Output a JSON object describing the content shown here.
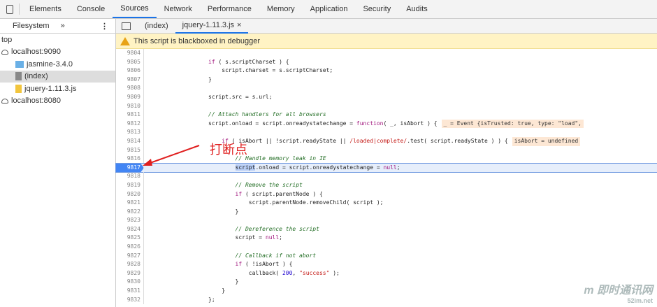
{
  "toolbar": {
    "tabs": [
      "Elements",
      "Console",
      "Sources",
      "Network",
      "Performance",
      "Memory",
      "Application",
      "Security",
      "Audits"
    ],
    "active": "Sources"
  },
  "navigator": {
    "tab": "Filesystem",
    "more": "»",
    "menu": "⋮",
    "tree": [
      {
        "label": "top",
        "type": "frame",
        "indent": 0
      },
      {
        "label": "localhost:9090",
        "type": "cloud",
        "indent": 0
      },
      {
        "label": "jasmine-3.4.0",
        "type": "folder",
        "indent": 1
      },
      {
        "label": "(index)",
        "type": "file-gray",
        "indent": 1,
        "selected": true
      },
      {
        "label": "jquery-1.11.3.js",
        "type": "file-yellow",
        "indent": 1
      },
      {
        "label": "localhost:8080",
        "type": "cloud",
        "indent": 0
      }
    ]
  },
  "editor": {
    "tabs": [
      {
        "label": "(index)"
      },
      {
        "label": "jquery-1.11.3.js",
        "active": true,
        "close": "×"
      }
    ],
    "warning": "This script is blackboxed in debugger",
    "breakpoint_line": 9817,
    "lines": [
      {
        "n": "9804",
        "code": ""
      },
      {
        "n": "9805",
        "code": "if ( s.scriptCharset ) {"
      },
      {
        "n": "9806",
        "code": "    script.charset = s.scriptCharset;"
      },
      {
        "n": "9807",
        "code": "}"
      },
      {
        "n": "9808",
        "code": ""
      },
      {
        "n": "9809",
        "code": "script.src = s.url;"
      },
      {
        "n": "9810",
        "code": ""
      },
      {
        "n": "9811",
        "code": "// Attach handlers for all browsers"
      },
      {
        "n": "9812",
        "code": "script.onload = script.onreadystatechange = function( _, isAbort ) {",
        "inline": "_ = Event {isTrusted: true, type: \"load\","
      },
      {
        "n": "9813",
        "code": ""
      },
      {
        "n": "9814",
        "code": "    if ( isAbort || !script.readyState || /loaded|complete/.test( script.readyState ) ) {",
        "inline": "isAbort = undefined"
      },
      {
        "n": "9815",
        "code": ""
      },
      {
        "n": "9816",
        "code": "        // Handle memory leak in IE"
      },
      {
        "n": "9817",
        "code": "        script.onload = script.onreadystatechange = null;"
      },
      {
        "n": "9818",
        "code": ""
      },
      {
        "n": "9819",
        "code": "        // Remove the script"
      },
      {
        "n": "9820",
        "code": "        if ( script.parentNode ) {"
      },
      {
        "n": "9821",
        "code": "            script.parentNode.removeChild( script );"
      },
      {
        "n": "9822",
        "code": "        }"
      },
      {
        "n": "9823",
        "code": ""
      },
      {
        "n": "9824",
        "code": "        // Dereference the script"
      },
      {
        "n": "9825",
        "code": "        script = null;"
      },
      {
        "n": "9826",
        "code": ""
      },
      {
        "n": "9827",
        "code": "        // Callback if not abort"
      },
      {
        "n": "9828",
        "code": "        if ( !isAbort ) {"
      },
      {
        "n": "9829",
        "code": "            callback( 200, \"success\" );"
      },
      {
        "n": "9830",
        "code": "        }"
      },
      {
        "n": "9831",
        "code": "    }"
      },
      {
        "n": "9832",
        "code": "};"
      }
    ]
  },
  "annotation": "打断点",
  "watermark": {
    "logo": "m 即时通讯网",
    "url": "52im.net"
  },
  "colors": {
    "accent": "#1a73e8",
    "breakpoint": "#4285f4",
    "annotation": "#e02020",
    "warning_bg": "#fff3c4"
  }
}
